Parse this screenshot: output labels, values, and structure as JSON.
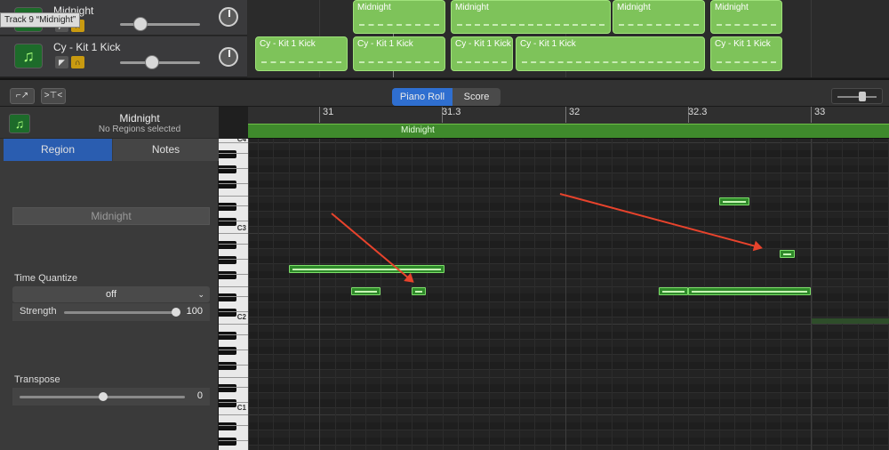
{
  "tooltip": "Track 9 “Midnight”",
  "tracks": [
    {
      "name": "Midnight",
      "icon": "music-note-icon"
    },
    {
      "name": "Cy - Kit 1 Kick",
      "icon": "music-note-icon"
    }
  ],
  "top_regions": {
    "row1": [
      "Midnight",
      "Midnight",
      "Midnight",
      "Midnight"
    ],
    "row2": [
      "Cy - Kit 1 Kick",
      "Cy - Kit 1 Kick",
      "Cy - Kit 1 Kick",
      "Cy - Kit 1 Kick",
      "Cy - Kit 1 Kick"
    ]
  },
  "toolbar": {
    "piano_roll": "Piano Roll",
    "score": "Score",
    "tool1": "⌐↗",
    "tool2": ">⊤<"
  },
  "inspector": {
    "title": "Midnight",
    "subtitle": "No Regions selected",
    "tab_region": "Region",
    "tab_notes": "Notes",
    "region_name": "Midnight",
    "time_quantize_label": "Time Quantize",
    "time_quantize_value": "off",
    "strength_label": "Strength",
    "strength_value": "100",
    "transpose_label": "Transpose",
    "transpose_value": "0"
  },
  "ruler": {
    "labels": [
      "31",
      "31.3",
      "32",
      "32.3",
      "33"
    ],
    "region_label": "Midnight"
  },
  "keyboard": {
    "labels": [
      "C4",
      "C3",
      "C2",
      "C1"
    ]
  },
  "colors": {
    "accent": "#2f6fd0",
    "region": "#7ec35a",
    "note": "#2f8a2a",
    "arrow": "#e8432c"
  }
}
